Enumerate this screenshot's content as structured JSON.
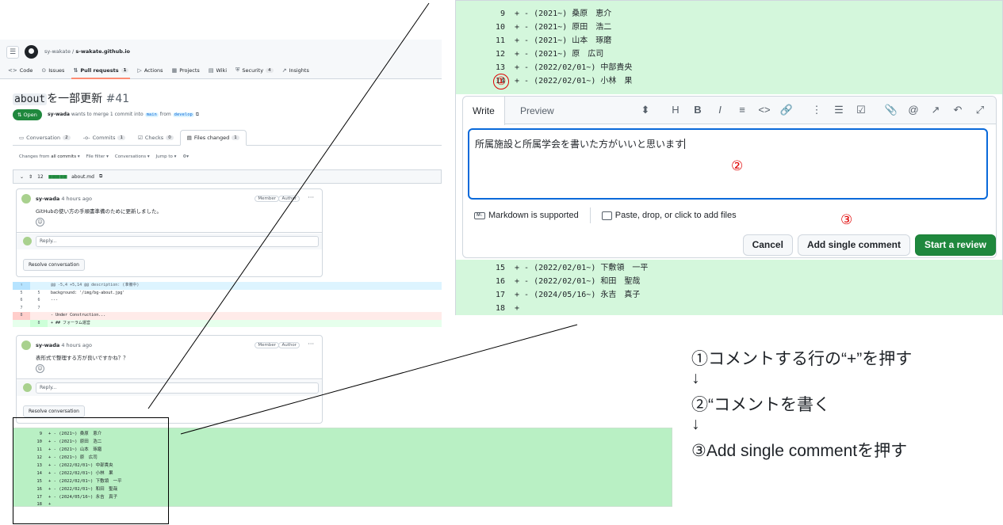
{
  "left": {
    "repo": {
      "owner": "sy-wakate",
      "separator": "/",
      "name": "s-wakate.github.io"
    },
    "repo_tabs": [
      {
        "icon": "<>",
        "label": "Code",
        "count": ""
      },
      {
        "icon": "⊙",
        "label": "Issues",
        "count": ""
      },
      {
        "icon": "⇅",
        "label": "Pull requests",
        "count": "1"
      },
      {
        "icon": "▷",
        "label": "Actions",
        "count": ""
      },
      {
        "icon": "▦",
        "label": "Projects",
        "count": ""
      },
      {
        "icon": "▤",
        "label": "Wiki",
        "count": ""
      },
      {
        "icon": "⛨",
        "label": "Security",
        "count": "4"
      },
      {
        "icon": "↗",
        "label": "Insights",
        "count": ""
      }
    ],
    "pr": {
      "title_code": "about",
      "title_rest": "を一部更新",
      "number": "#41",
      "status": "Open",
      "author": "sy-wada",
      "meta_1": "wants to merge 1 commit into",
      "base_branch": "main",
      "meta_2": "from",
      "head_branch": "develop"
    },
    "pr_tabs": [
      {
        "label": "Conversation",
        "count": "2"
      },
      {
        "label": "Commits",
        "count": "1"
      },
      {
        "label": "Checks",
        "count": "0"
      },
      {
        "label": "Files changed",
        "count": "1"
      }
    ],
    "toolbar": {
      "changes_prefix": "Changes from",
      "changes_value": "all commits",
      "file_filter": "File filter",
      "conversations": "Conversations",
      "jump_to": "Jump to"
    },
    "file": {
      "lines": "12",
      "name": "about.md"
    },
    "comments": [
      {
        "author": "sy-wada",
        "time": "4 hours ago",
        "badge1": "Member",
        "badge2": "Author",
        "body": "GitHubの使い方の手順書準備のために更新しました。",
        "reply": "Reply...",
        "resolve": "Resolve conversation"
      },
      {
        "author": "sy-wada",
        "time": "4 hours ago",
        "badge1": "Member",
        "badge2": "Author",
        "body": "表形式で整理する方が良いですかね？？",
        "reply": "Reply...",
        "resolve": "Resolve conversation"
      }
    ],
    "diff": [
      {
        "kind": "hunk",
        "old": "",
        "new": "",
        "text": "@@ -5,4 +5,14 @@ description: (准備中)"
      },
      {
        "kind": "ctx",
        "old": "5",
        "new": "5",
        "text": "  background: '/img/bg-about.jpg'"
      },
      {
        "kind": "ctx",
        "old": "6",
        "new": "6",
        "text": "  ---"
      },
      {
        "kind": "ctx",
        "old": "7",
        "new": "7",
        "text": ""
      },
      {
        "kind": "del",
        "old": "8",
        "new": "",
        "text": "- Under Construction..."
      },
      {
        "kind": "add",
        "old": "",
        "new": "8",
        "text": "+ ## フォーラム運営"
      }
    ],
    "bottom_lines": [
      {
        "n": "9",
        "t": "+ - (2021~) 桑原　恵介"
      },
      {
        "n": "10",
        "t": "+ - (2021~) 原田　浩二"
      },
      {
        "n": "11",
        "t": "+ - (2021~) 山本　琢磨"
      },
      {
        "n": "12",
        "t": "+ - (2021~) 原　広司"
      },
      {
        "n": "13",
        "t": "+ - (2022/02/01~) 中部貴央"
      },
      {
        "n": "14",
        "t": "+ - (2022/02/01~) 小林　果"
      },
      {
        "n": "15",
        "t": "+ - (2022/02/01~) 下敷領　一平"
      },
      {
        "n": "16",
        "t": "+ - (2022/02/01~) 和田　聖哉"
      },
      {
        "n": "17",
        "t": "+ - (2024/05/16~) 永吉　真子"
      },
      {
        "n": "18",
        "t": "+"
      }
    ]
  },
  "right": {
    "top_lines": [
      {
        "n": "9",
        "t": "+ - (2021~) 桑原　恵介"
      },
      {
        "n": "10",
        "t": "+ - (2021~) 原田　浩二"
      },
      {
        "n": "11",
        "t": "+ - (2021~) 山本　琢磨"
      },
      {
        "n": "12",
        "t": "+ - (2021~) 原　広司"
      },
      {
        "n": "13",
        "t": "+ - (2022/02/01~) 中部貴央"
      },
      {
        "n": "14",
        "t": "+ - (2022/02/01~) 小林　果"
      }
    ],
    "editor": {
      "tab_write": "Write",
      "tab_preview": "Preview",
      "text": "所属施設と所属学会を書いた方がいいと思います",
      "markdown": "Markdown is supported",
      "paste": "Paste, drop, or click to add files",
      "tools": [
        "⬍",
        "H",
        "B",
        "I",
        "≡",
        "<>",
        "🔗",
        "⋮",
        "☰",
        "☑",
        "📎",
        "@",
        "↗",
        "↶",
        "⤢"
      ]
    },
    "buttons": {
      "cancel": "Cancel",
      "add_single": "Add single comment",
      "start_review": "Start a review"
    },
    "bottom_lines": [
      {
        "n": "15",
        "t": "+ - (2022/02/01~) 下敷領　一平"
      },
      {
        "n": "16",
        "t": "+ - (2022/02/01~) 和田　聖哉"
      },
      {
        "n": "17",
        "t": "+ - (2024/05/16~) 永吉　真子"
      },
      {
        "n": "18",
        "t": "+"
      }
    ],
    "markers": {
      "m1": "①",
      "m2": "②",
      "m3": "③"
    }
  },
  "instructions": {
    "step1": "①コメントする行の“+”を押す",
    "arrow1": "↓",
    "step2": "②“コメントを書く",
    "arrow2": "↓",
    "step3": "③Add single commentを押す"
  },
  "colors": {
    "green_button": "#1f883d",
    "added_line_bg": "#d4f7dc",
    "marker_red": "#e00000",
    "focus_blue": "#0969da"
  }
}
